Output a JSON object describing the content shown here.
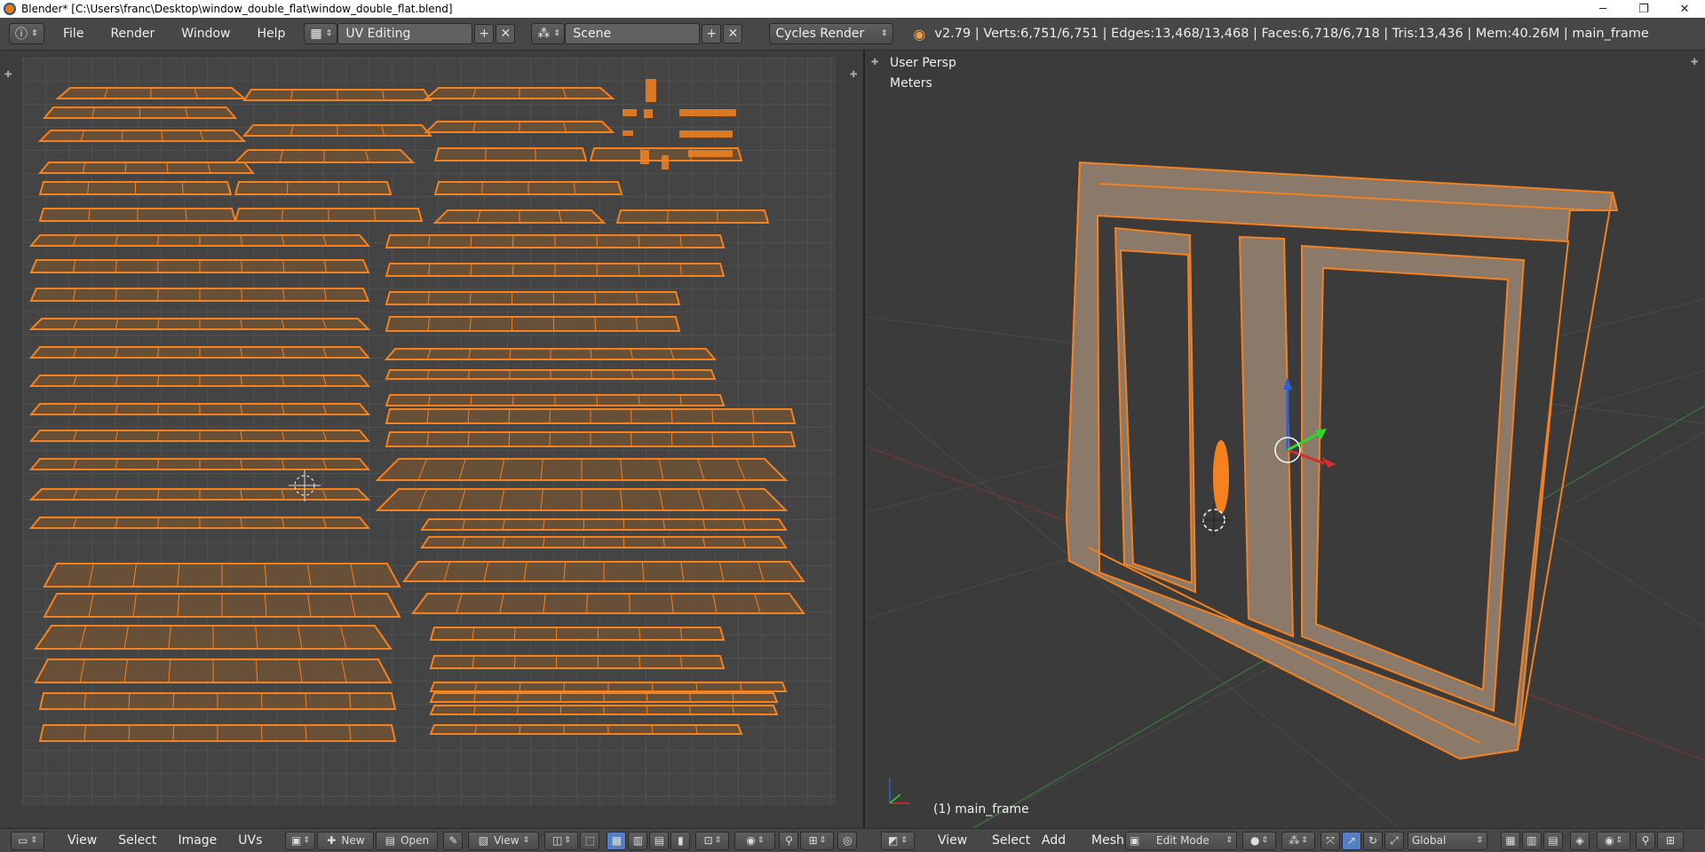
{
  "window": {
    "title": "Blender* [C:\\Users\\franc\\Desktop\\window_double_flat\\window_double_flat.blend]",
    "minimize": "─",
    "maximize": "❐",
    "close": "✕"
  },
  "info_header": {
    "menus": [
      "File",
      "Render",
      "Window",
      "Help"
    ],
    "screen_layout": "UV Editing",
    "scene": "Scene",
    "render_engine": "Cycles Render",
    "stats": "v2.79 | Verts:6,751/6,751 | Edges:13,468/13,468 | Faces:6,718/6,718 | Tris:13,436 | Mem:40.26M | main_frame"
  },
  "viewport": {
    "view_name": "User Persp",
    "units": "Meters",
    "object_label": "(1) main_frame"
  },
  "uv_footer": {
    "menus": [
      "View",
      "Select",
      "Image",
      "UVs"
    ],
    "new_label": "New",
    "open_label": "Open",
    "view_label": "View"
  },
  "view3d_footer": {
    "menus": [
      "View",
      "Select",
      "Add",
      "Mesh"
    ],
    "mode": "Edit Mode",
    "orientation": "Global"
  },
  "colors": {
    "selection": "#f5811f",
    "face_fill": "#7a5a3c",
    "background": "#3d3d3d"
  }
}
